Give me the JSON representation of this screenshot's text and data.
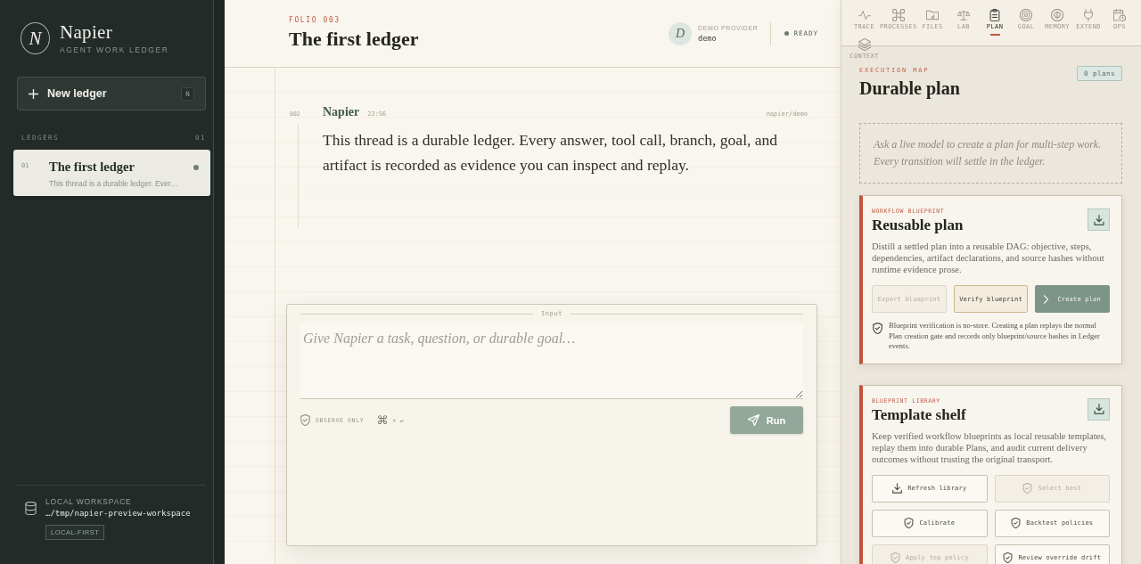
{
  "sidebar": {
    "brand": {
      "mark": "N",
      "name": "Napier",
      "tagline": "AGENT WORK LEDGER"
    },
    "new_button": {
      "label": "New ledger",
      "shortcut": "N"
    },
    "section": {
      "title": "LEDGERS",
      "count": "01"
    },
    "ledgers": [
      {
        "number": "01",
        "title": "The first ledger",
        "preview": "This thread is a durable ledger. Ever…",
        "selected": true
      }
    ],
    "workspace": {
      "label": "LOCAL WORKSPACE",
      "path": "…/tmp/napier-preview-workspace",
      "badge": "LOCAL-FIRST"
    }
  },
  "header": {
    "eyebrow": "FOLIO 003",
    "title": "The first ledger",
    "provider": {
      "avatar": "D",
      "label": "DEMO PROVIDER",
      "name": "demo"
    },
    "status": "READY"
  },
  "messages": [
    {
      "number": "002",
      "author": "Napier",
      "time": "22:56",
      "source": "napier/demo",
      "text": "This thread is a durable ledger. Every answer, tool call, branch, goal, and artifact is recorded as evidence you can inspect and replay."
    }
  ],
  "composer": {
    "label": "Input",
    "placeholder": "Give Napier a task, question, or durable goal…",
    "mode": "OBSERVE ONLY",
    "shortcut_symbol": "⌘",
    "shortcut": "× ↵",
    "button": "Run"
  },
  "inspector": {
    "tabs": [
      {
        "label": "TRACE",
        "selected": false
      },
      {
        "label": "PROCESSES",
        "selected": false
      },
      {
        "label": "FILES",
        "selected": false
      },
      {
        "label": "LAB",
        "selected": false
      },
      {
        "label": "PLAN",
        "selected": true
      },
      {
        "label": "GOAL",
        "selected": false
      },
      {
        "label": "MEMORY",
        "selected": false
      },
      {
        "label": "EXTEND",
        "selected": false
      },
      {
        "label": "OPS",
        "selected": false
      },
      {
        "label": "CONTEXT",
        "selected": false
      }
    ],
    "eyebrow": "EXECUTION MAP",
    "title": "Durable plan",
    "badge": "0 plans",
    "empty_note": "Ask a live model to create a plan for multi-step work. Every transition will settle in the ledger.",
    "cards": [
      {
        "kind": "strip",
        "eyebrow": "WORKFLOW BLUEPRINT",
        "title": "Reusable plan",
        "description": "Distill a settled plan into a reusable DAG: objective, steps, dependencies, artifact declarations, and source hashes without runtime evidence prose.",
        "actions": [
          {
            "label": "Export blueprint",
            "kind": "plain",
            "disabled": true
          },
          {
            "label": "Verify blueprint",
            "kind": "accent",
            "disabled": false
          },
          {
            "label": "Create plan",
            "kind": "primary",
            "disabled": false
          }
        ],
        "note": "Blueprint verification is no-store. Creating a plan replays the normal Plan creation gate and records only blueprint/source hashes in Ledger events."
      },
      {
        "kind": "grid",
        "eyebrow": "BLUEPRINT LIBRARY",
        "title": "Template shelf",
        "description": "Keep verified workflow blueprints as local reusable templates, replay them into durable Plans, and audit current delivery outcomes without trusting the original transport.",
        "actions": [
          {
            "label": "Refresh library",
            "kind": "plain",
            "disabled": false
          },
          {
            "label": "Select best",
            "kind": "plain",
            "disabled": true
          },
          {
            "label": "Calibrate",
            "kind": "plain",
            "disabled": false
          },
          {
            "label": "Backtest policies",
            "kind": "plain",
            "disabled": false
          },
          {
            "label": "Apply top policy",
            "kind": "plain",
            "disabled": true
          },
          {
            "label": "Review override drift",
            "kind": "plain",
            "disabled": false
          }
        ]
      }
    ]
  }
}
